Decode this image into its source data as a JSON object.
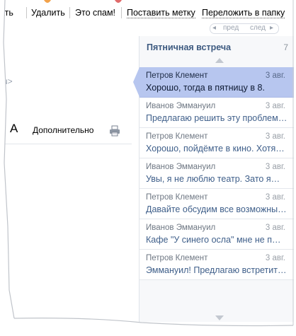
{
  "toolbar": {
    "reply_fragment": "ать",
    "delete": "Удалить",
    "spam": "Это спам!",
    "mark": "Поставить метку",
    "move": "Переложить в папку"
  },
  "nav": {
    "prev": "пред",
    "next": "след"
  },
  "left": {
    "addr_fragment": "ru>",
    "font_small": "A",
    "font_big": "A",
    "more": "Дополнительно"
  },
  "thread": {
    "title": "Пятничная встреча",
    "count": "7",
    "messages": [
      {
        "from": "Петров Клемент",
        "date": "3 авг.",
        "snippet": "Хорошо, тогда в пятницу в 8.",
        "active": true
      },
      {
        "from": "Иванов Эммануил",
        "date": "3 авг.",
        "snippet": "Предлагаю решить эту проблему…"
      },
      {
        "from": "Петров Клемент",
        "date": "3 авг.",
        "snippet": "Хорошо, пойдёмте в кино. Хотя…"
      },
      {
        "from": "Иванов Эммануил",
        "date": "3 авг.",
        "snippet": "Увы, я не люблю театр. Зато я…"
      },
      {
        "from": "Петров Клемент",
        "date": "3 авг.",
        "snippet": "Давайте обсудим все возможные…"
      },
      {
        "from": "Иванов Эммануил",
        "date": "3 авг.",
        "snippet": "Кафе \"У синего осла\" мне не п…"
      },
      {
        "from": "Петров Клемент",
        "date": "3 авг.",
        "snippet": "Эммануил! Предлагаю встретиться…"
      }
    ]
  },
  "colors": {
    "accent": "#b7c6ef",
    "link": "#3f5f8a",
    "title": "#3d5a80"
  }
}
